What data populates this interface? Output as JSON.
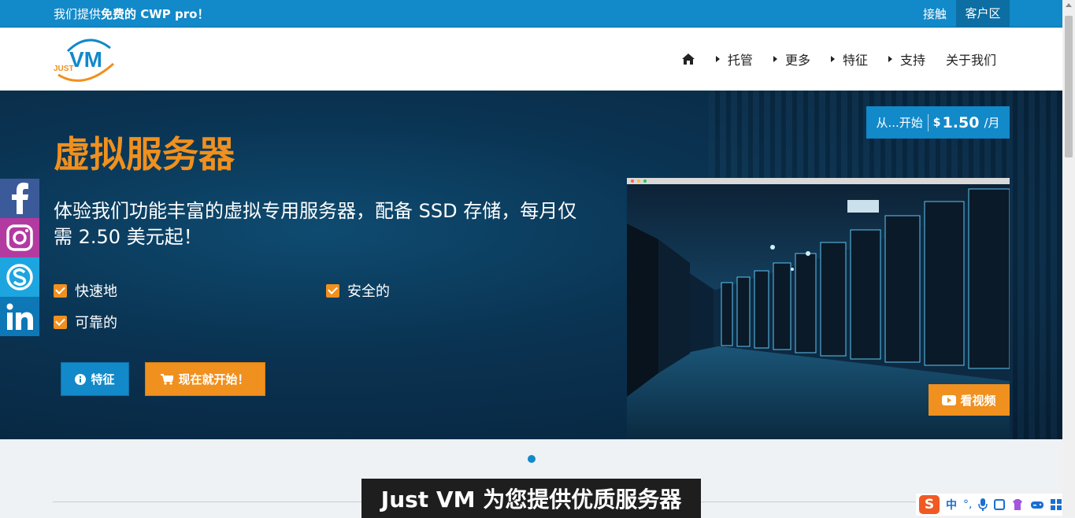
{
  "topbar": {
    "promo_pre": "我们提供",
    "promo_bold": "免费的 CWP pro！",
    "contact": "接触",
    "client_area": "客户区"
  },
  "brand": {
    "logo_small": "JUST",
    "logo_big": "VM",
    "colors": {
      "blue": "#1289c9",
      "orange": "#f0901e"
    }
  },
  "nav": {
    "home_icon": "home-icon",
    "items": [
      "托管",
      "更多",
      "特征",
      "支持",
      "关于我们"
    ]
  },
  "hero": {
    "title": "虚拟服务器",
    "subtitle": "体验我们功能丰富的虚拟专用服务器，配备 SSD 存储，每月仅需 2.50 美元起！",
    "features": [
      "快速地",
      "安全的",
      "可靠的"
    ],
    "btn_features": "特征",
    "btn_start": "现在就开始！",
    "price_from": "从...开始",
    "price_currency": "$",
    "price_amount": "1.50",
    "price_period": "/月",
    "watch_video": "看视频"
  },
  "social": [
    "facebook-icon",
    "instagram-icon",
    "skype-icon",
    "linkedin-icon"
  ],
  "section": {
    "title": "Just VM 为您提供优质服务器"
  },
  "ime": {
    "lang": "中",
    "punct": "°,"
  }
}
